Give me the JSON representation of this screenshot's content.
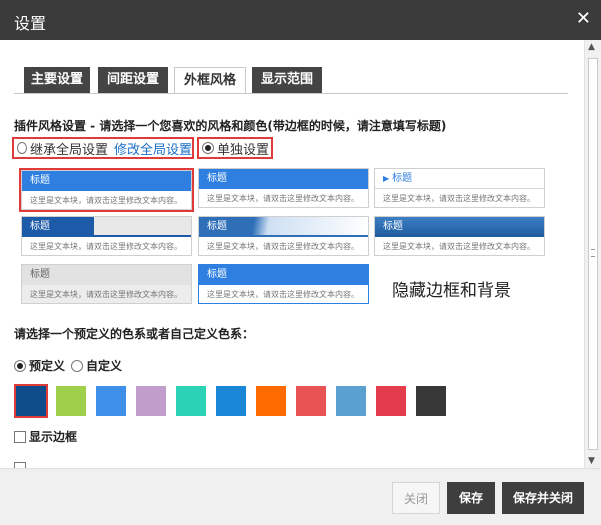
{
  "dialog": {
    "title": "设置"
  },
  "tabs": [
    {
      "label": "主要设置"
    },
    {
      "label": "间距设置"
    },
    {
      "label": "外框风格"
    },
    {
      "label": "显示范围"
    }
  ],
  "frame_style": {
    "section_title": "插件风格设置 - 请选择一个您喜欢的风格和颜色(带边框的时候，请注意填写标题)",
    "inherit_label": "继承全局设置",
    "modify_global_link": "修改全局设置",
    "separate_label": "单独设置",
    "options": [
      {
        "header": "标题",
        "body": "这里是文本块，请双击这里修改文本内容。"
      },
      {
        "header": "标题",
        "body": "这里是文本块，请双击这里修改文本内容。"
      },
      {
        "header": "标题",
        "body": "这里是文本块，请双击这里修改文本内容。"
      },
      {
        "header": "标题",
        "body": "这里是文本块，请双击这里修改文本内容。"
      },
      {
        "header": "标题",
        "body": "这里是文本块，请双击这里修改文本内容。"
      },
      {
        "header": "标题",
        "body": "这里是文本块，请双击这里修改文本内容。"
      },
      {
        "header": "标题",
        "body": "这里是文本块，请双击这里修改文本内容。"
      },
      {
        "header": "标题",
        "body": "这里是文本块，请双击这里修改文本内容。"
      }
    ],
    "hide_option": "隐藏边框和背景"
  },
  "colors": {
    "prompt": "请选择一个预定义的色系或者自己定义色系：",
    "predefined_label": "预定义",
    "custom_label": "自定义",
    "swatches": [
      "#0f4c8a",
      "#a0cf4c",
      "#3d8fe8",
      "#c19dcb",
      "#2bd3b4",
      "#1a86d6",
      "#ff6a00",
      "#e95353",
      "#5aa0d0",
      "#e43c4c",
      "#383838"
    ],
    "selected": "#0f4c8a"
  },
  "show_border": {
    "label": "显示边框"
  },
  "footer": {
    "close": "关闭",
    "save": "保存",
    "save_close": "保存并关闭"
  }
}
